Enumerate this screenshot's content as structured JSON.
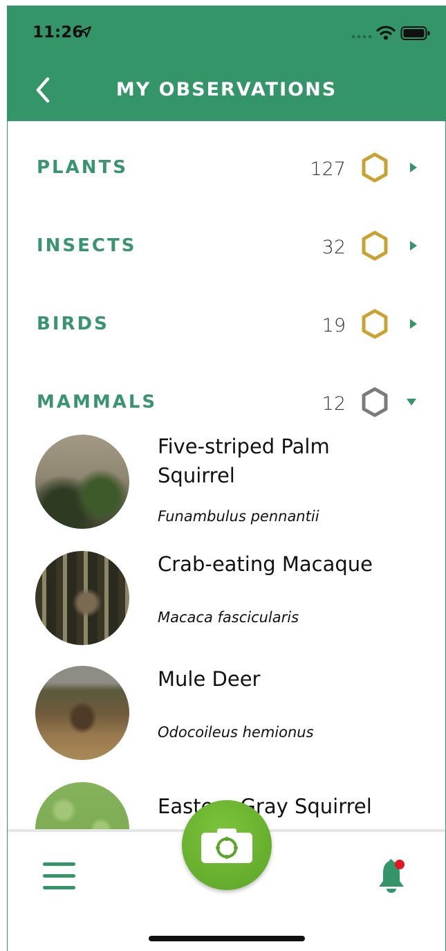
{
  "status_bar": {
    "time": "11:26"
  },
  "header": {
    "title": "MY OBSERVATIONS"
  },
  "categories": [
    {
      "label": "PLANTS",
      "count": "127",
      "badge_color": "#c9a232",
      "expanded": false
    },
    {
      "label": "INSECTS",
      "count": "32",
      "badge_color": "#c9a232",
      "expanded": false
    },
    {
      "label": "BIRDS",
      "count": "19",
      "badge_color": "#c9a232",
      "expanded": false
    },
    {
      "label": "MAMMALS",
      "count": "12",
      "badge_color": "#7b7b7b",
      "expanded": true
    }
  ],
  "observations": [
    {
      "name": "Five-striped Palm Squirrel",
      "scientific": "Funambulus pennantii"
    },
    {
      "name": "Crab-eating Macaque",
      "scientific": "Macaca fascicularis"
    },
    {
      "name": "Mule Deer",
      "scientific": "Odocoileus hemionus"
    },
    {
      "name": "Eastern Gray Squirrel",
      "scientific": ""
    }
  ],
  "colors": {
    "brand_green": "#349569",
    "label_green": "#3a9371",
    "camera_green": "#6cb332"
  },
  "icons": {
    "back": "chevron-left-icon",
    "menu": "hamburger-icon",
    "notifications": "bell-icon",
    "camera": "camera-icon"
  }
}
